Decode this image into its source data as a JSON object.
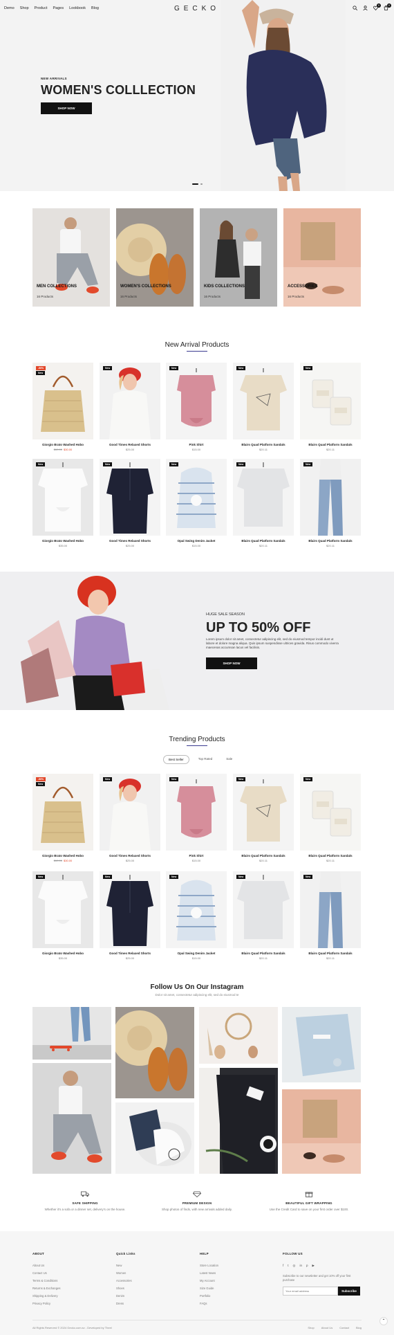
{
  "header": {
    "nav": [
      "Demo",
      "Shop",
      "Product",
      "Pages",
      "Lookbook",
      "Blog"
    ],
    "logo": "GECKO",
    "icons": [
      "search-icon",
      "user-icon",
      "wishlist-icon",
      "cart-icon"
    ],
    "wishlist_count": "0",
    "cart_count": "0"
  },
  "hero": {
    "eyebrow": "NEW ARRIVALS",
    "title": "WOMEN'S COLLLECTION",
    "button": "SHOP NOW"
  },
  "collections": [
    {
      "name": "MEN COLLECTIONS",
      "count": "16 Products"
    },
    {
      "name": "WOMEN'S COLLECTIONS",
      "count": "16 Products"
    },
    {
      "name": "KIDS COLLECTIONS",
      "count": "16 Products"
    },
    {
      "name": "ACCESSORIES",
      "count": "16 Products"
    }
  ],
  "new_arrivals": {
    "title": "New Arrival Products",
    "products": [
      {
        "name": "Giorgio Brato Washed Hobo",
        "old_price": "$60.00",
        "price": "$30.00",
        "tags": [
          "-50%",
          "New"
        ]
      },
      {
        "name": "Good Times Relaxed Shorts",
        "price": "$25.00",
        "tags": [
          "New"
        ]
      },
      {
        "name": "Pink Shirt",
        "price": "$15.00",
        "tags": [
          "New"
        ]
      },
      {
        "name": "Blairs Quad Platform Sandals",
        "price": "$20.11",
        "tags": [
          "New"
        ]
      },
      {
        "name": "Blairs Quad Platform Sandals",
        "price": "$20.11",
        "tags": [
          "New"
        ]
      },
      {
        "name": "Giorgio Brato Washed Hobo",
        "price": "$35.00",
        "tags": [
          "New"
        ]
      },
      {
        "name": "Good Times Relaxed Shorts",
        "price": "$25.00",
        "tags": [
          "New"
        ]
      },
      {
        "name": "Opal Swing Denim Jacket",
        "price": "$15.00",
        "tags": [
          "New"
        ]
      },
      {
        "name": "Blairs Quad Platform Sandals",
        "price": "$20.11",
        "tags": [
          "New"
        ]
      },
      {
        "name": "Blairs Quad Platform Sandals",
        "price": "$20.11",
        "tags": [
          "New"
        ]
      }
    ]
  },
  "promo": {
    "eyebrow": "HUGE SALE SEASON",
    "title": "UP TO 50% OFF",
    "text": "Lorem ipsum dolor sit amet, consectetur adipiscing elit, sed do eiusmod tempor incidi dunt ut labore et dolore magna aliqua. Quis ipsum suspendisse ultrices gravida. Risus commodo viverra maecenas accumsan lacus vel facilisis.",
    "button": "SHOP NOW"
  },
  "trending": {
    "title": "Trending Products",
    "tabs": [
      "Best Seller",
      "Top Rated",
      "Sale"
    ],
    "products": [
      {
        "name": "Giorgio Brato Washed Hobo",
        "old_price": "$60.00",
        "price": "$30.00",
        "tags": [
          "-50%",
          "New"
        ]
      },
      {
        "name": "Good Times Relaxed Shorts",
        "price": "$25.00",
        "tags": [
          "New"
        ]
      },
      {
        "name": "Pink Shirt",
        "price": "$15.00",
        "tags": [
          "New"
        ]
      },
      {
        "name": "Blairs Quad Platform Sandals",
        "price": "$20.11",
        "tags": [
          "New"
        ]
      },
      {
        "name": "Blairs Quad Platform Sandals",
        "price": "$20.11",
        "tags": [
          "New"
        ]
      },
      {
        "name": "Giorgio Brato Washed Hobo",
        "price": "$35.00",
        "tags": [
          "New"
        ]
      },
      {
        "name": "Good Times Relaxed Shorts",
        "price": "$25.00",
        "tags": [
          "New"
        ]
      },
      {
        "name": "Opal Swing Denim Jacket",
        "price": "$15.00",
        "tags": [
          "New"
        ]
      },
      {
        "name": "Blairs Quad Platform Sandals",
        "price": "$20.11",
        "tags": [
          "New"
        ]
      },
      {
        "name": "Blairs Quad Platform Sandals",
        "price": "$20.11",
        "tags": [
          "New"
        ]
      }
    ]
  },
  "instagram": {
    "title": "Follow Us On Our Instagram",
    "subtitle": "Dolor sit amet, consectetur adipiscing elit, sed do eiusmod te"
  },
  "features": [
    {
      "icon": "truck-icon",
      "title": "SAFE SHIPPING",
      "text": "Whether it's a sofa or a dinner set, delivery's on the house."
    },
    {
      "icon": "diamond-icon",
      "title": "PREMIUM DESIGN",
      "text": "Shop photos of finds, with new arrivals added daily."
    },
    {
      "icon": "gift-icon",
      "title": "BEAUTIFUL GIFT WRAPPING",
      "text": "Use the Credit Card to save on your first order over $100."
    }
  ],
  "footer": {
    "about": {
      "title": "ABOUT",
      "links": [
        "About Us",
        "Contact Us",
        "Terms & Conditions",
        "Returns & Exchanges",
        "Shipping & Delivery",
        "Privacy Policy"
      ]
    },
    "quick": {
      "title": "Quick Links",
      "links": [
        "New",
        "Women",
        "Accessories",
        "Shoes",
        "Denim",
        "Dress"
      ]
    },
    "help": {
      "title": "HELP",
      "links": [
        "Store Location",
        "Latest News",
        "My Account",
        "Size Guide",
        "Portfolio",
        "FAQs"
      ]
    },
    "follow": {
      "title": "FOLLOW US",
      "text": "Subscribe to our newsletter and get 10% off your first purchase"
    },
    "social_icons": [
      "facebook-icon",
      "twitter-icon",
      "instagram-icon",
      "linkedin-icon",
      "pinterest-icon",
      "youtube-icon"
    ],
    "newsletter_placeholder": "Your email address",
    "newsletter_button": "Subscribe",
    "copyright": "All Rights Reserved © 2024 Gecko.com.sv - Developed by Theel",
    "links": [
      "Shop",
      "About Us",
      "Contact",
      "Blog"
    ]
  },
  "colors": {
    "accent": "#3b3b90",
    "sale": "#e2482b",
    "dark": "#111111"
  }
}
